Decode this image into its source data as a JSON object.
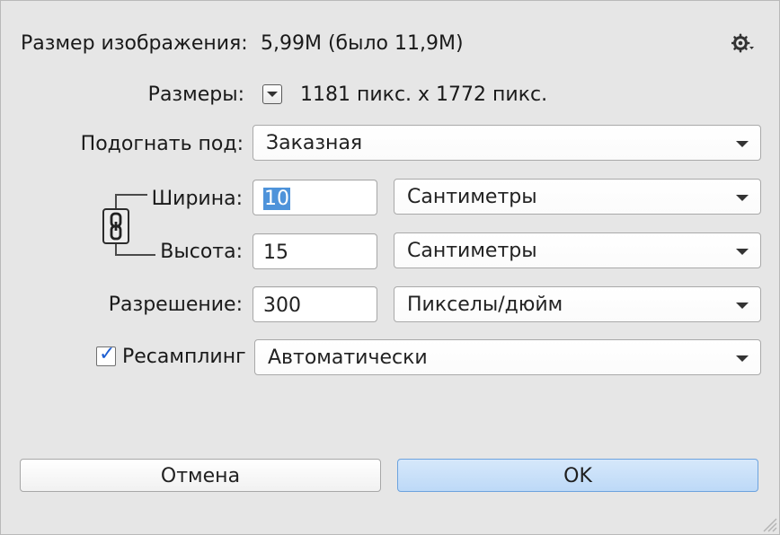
{
  "dialog": {
    "image_size_label": "Размер изображения:",
    "image_size_value": "5,99M (было 11,9M)",
    "dimensions_label": "Размеры:",
    "dimensions_value": "1181 пикс. x 1772 пикс.",
    "fit_to_label": "Подогнать под:",
    "fit_to_value": "Заказная",
    "width_label": "Ширина:",
    "width_value": "10",
    "width_unit": "Сантиметры",
    "height_label": "Высота:",
    "height_value": "15",
    "height_unit": "Сантиметры",
    "resolution_label": "Разрешение:",
    "resolution_value": "300",
    "resolution_unit": "Пикселы/дюйм",
    "resample_label": "Ресамплинг",
    "resample_checked": true,
    "resample_value": "Автоматически",
    "cancel_label": "Отмена",
    "ok_label": "OK"
  },
  "icons": {
    "settings": "gear-icon",
    "dimensions_menu": "chevron-down-icon",
    "link": "chain-link-icon",
    "resample_check": "checkmark-icon"
  },
  "colors": {
    "dialog_background": "#e6e6e6",
    "selection": "#4e93da",
    "ok_button": "#c7def8",
    "checkmark": "#1e5fd2"
  }
}
